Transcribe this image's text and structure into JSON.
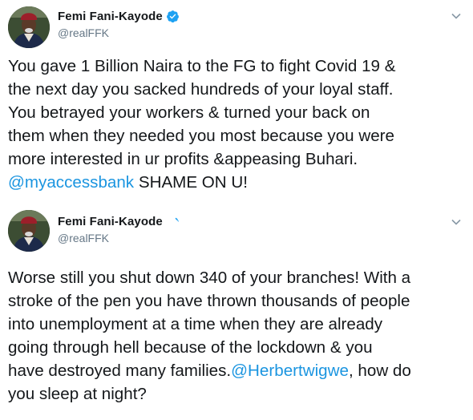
{
  "tweets": [
    {
      "display_name": "Femi Fani-Kayode",
      "handle": "@realFFK",
      "verified": true,
      "text_part1": "You gave 1 Billion Naira to the FG to fight Covid 19 &\nthe next day you sacked hundreds of your loyal staff.\nYou betrayed your workers & turned your back on\nthem when they needed you most because you were\nmore interested in ur profits &appeasing Buhari.\n",
      "mention": "@myaccessbank",
      "text_part2": " SHAME ON U!"
    },
    {
      "display_name": "Femi Fani-Kayode",
      "handle": "@realFFK",
      "verified": true,
      "text_part1": "Worse still you shut down 340 of your branches! With a\nstroke of the pen you have thrown thousands of people\ninto unemployment at a time when they are already\ngoing through hell because of the lockdown & you\nhave destroyed many families.",
      "mention": "@Herbertwigwe",
      "text_part2": ", how do\nyou sleep at night?"
    }
  ],
  "colors": {
    "mention": "#1b95e0",
    "verified_badge": "#1da1f2",
    "handle": "#657786",
    "text": "#14171a"
  },
  "icons": {
    "verified": "verified-badge-icon",
    "more": "chevron-down-icon"
  }
}
